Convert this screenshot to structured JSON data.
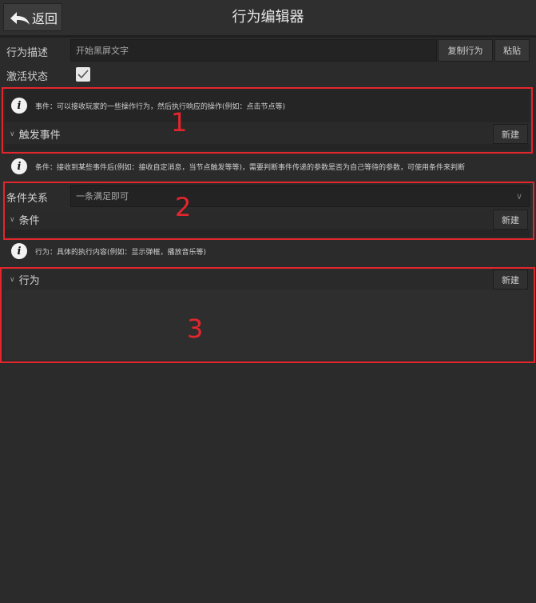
{
  "header": {
    "back_label": "返回",
    "title": "行为编辑器"
  },
  "description": {
    "label": "行为描述",
    "value": "开始黑屏文字",
    "copy_label": "复制行为",
    "paste_label": "粘贴"
  },
  "activation": {
    "label": "激活状态",
    "checked": true
  },
  "event_section": {
    "info": "事件：可以接收玩家的一些操作行为，然后执行响应的操作(例如：点击节点等)",
    "title": "触发事件",
    "new_label": "新建",
    "annotation": "1"
  },
  "condition_section": {
    "info": "条件：接收到某些事件后(例如：接收自定消息，当节点触发等等)，需要判断事件传递的参数是否为自己等待的参数，可使用条件来判断",
    "relation_label": "条件关系",
    "relation_value": "一条满足即可",
    "title": "条件",
    "new_label": "新建",
    "annotation": "2"
  },
  "action_section": {
    "info": "行为：具体的执行内容(例如：显示弹框，播放音乐等)",
    "title": "行为",
    "new_label": "新建",
    "annotation": "3"
  },
  "colors": {
    "annotation_red": "#e3262d",
    "background": "#2b2b2b"
  },
  "icons": {
    "back": "curved-back-arrow-icon",
    "info": "info-icon",
    "collapse": "chevron-down-icon",
    "check": "check-icon"
  }
}
